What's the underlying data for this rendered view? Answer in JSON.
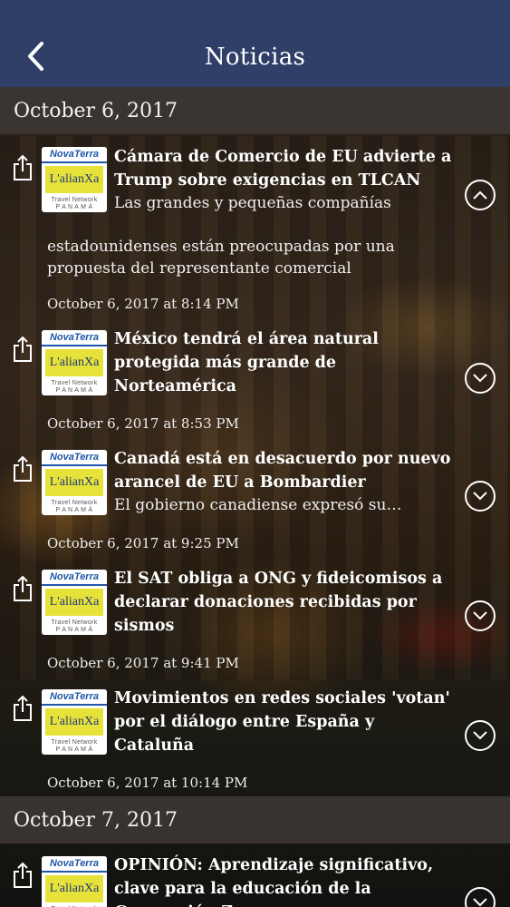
{
  "header": {
    "title": "Noticias",
    "back_icon": "chevron-left-icon"
  },
  "logo": {
    "top": "NovaTerra",
    "middle": "L'alianXa",
    "line1": "Travel Network",
    "line2": "P A N A M Á"
  },
  "sections": [
    {
      "date": "October 6, 2017"
    },
    {
      "date": "October 7, 2017"
    }
  ],
  "news": [
    {
      "title": "Cámara de Comercio de EU advierte a Trump sobre exigencias en TLCAN",
      "summary_first": "Las grandes y pequeñas compañías",
      "summary_rest": "estadounidenses están preocupadas por una propuesta del representante comercial",
      "timestamp": "October 6, 2017 at 8:14 PM",
      "expanded": true
    },
    {
      "title": "México tendrá el área natural protegida más grande de Norteamérica",
      "summary": "",
      "timestamp": "October 6, 2017 at 8:53 PM",
      "expanded": false
    },
    {
      "title": "Canadá está en desacuerdo por nuevo arancel de EU a Bombardier",
      "summary": "El gobierno canadiense expresó su…",
      "timestamp": "October 6, 2017 at 9:25 PM",
      "expanded": false
    },
    {
      "title": "El SAT obliga a ONG y fideicomisos a declarar donaciones recibidas por sismos",
      "summary": "",
      "timestamp": "October 6, 2017 at 9:41 PM",
      "expanded": false
    },
    {
      "title": "Movimientos en redes sociales 'votan' por el diálogo entre España y Cataluña",
      "summary": "",
      "timestamp": "October 6, 2017 at 10:14 PM",
      "expanded": false
    },
    {
      "title": "OPINIÓN: Aprendizaje significativo, clave para la educación de la Generación Z",
      "summary": "",
      "timestamp": "",
      "expanded": false
    }
  ]
}
